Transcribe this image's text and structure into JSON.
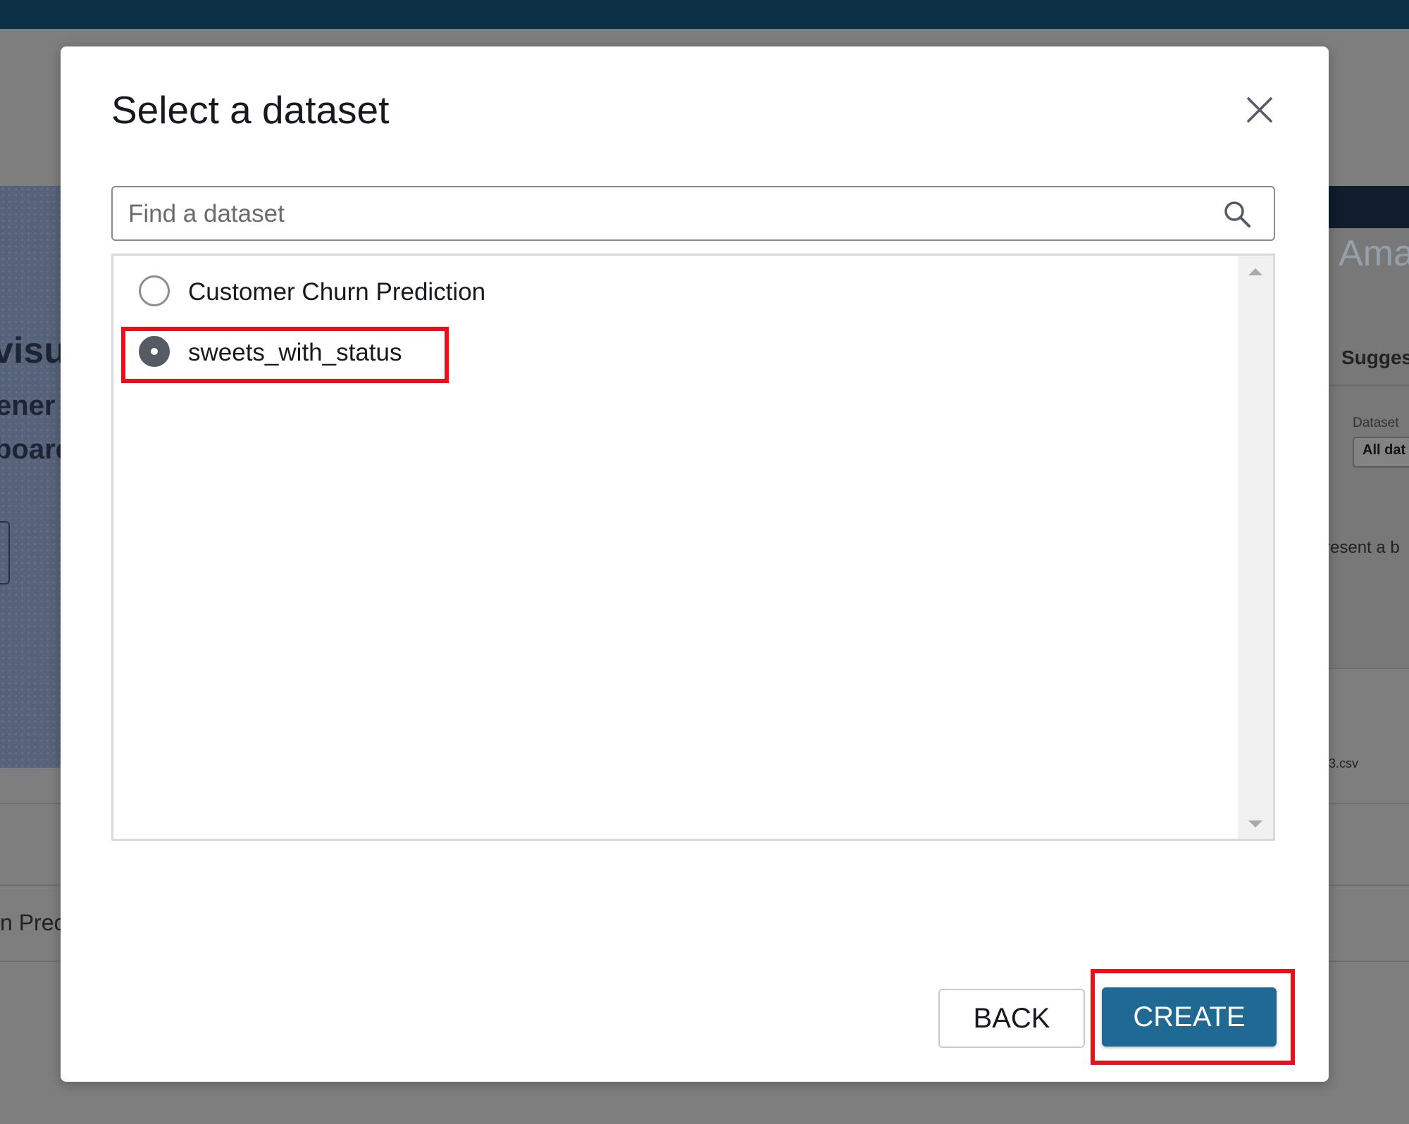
{
  "background": {
    "hero_lines": [
      "visua",
      "ener",
      "boarc"
    ],
    "left_row_text": "n Prec",
    "right_brand": "Ama",
    "right_tab": "Sugges",
    "right_filter_label": "Dataset",
    "right_filter_value": "All dat",
    "right_hint": "resent a b",
    "right_file": "3.csv"
  },
  "modal": {
    "title": "Select a dataset",
    "search": {
      "placeholder": "Find a dataset",
      "value": ""
    },
    "datasets": [
      {
        "label": "Customer Churn Prediction",
        "selected": false
      },
      {
        "label": "sweets_with_status",
        "selected": true
      }
    ],
    "buttons": {
      "back": "BACK",
      "create": "CREATE"
    }
  },
  "colors": {
    "primary_button": "#1e6a94",
    "highlight": "#e8101a",
    "topbar": "#0b3045",
    "radio_selected": "#545b64"
  },
  "icons": [
    "close-icon",
    "search-icon",
    "chevron-up-icon",
    "chevron-down-icon"
  ]
}
